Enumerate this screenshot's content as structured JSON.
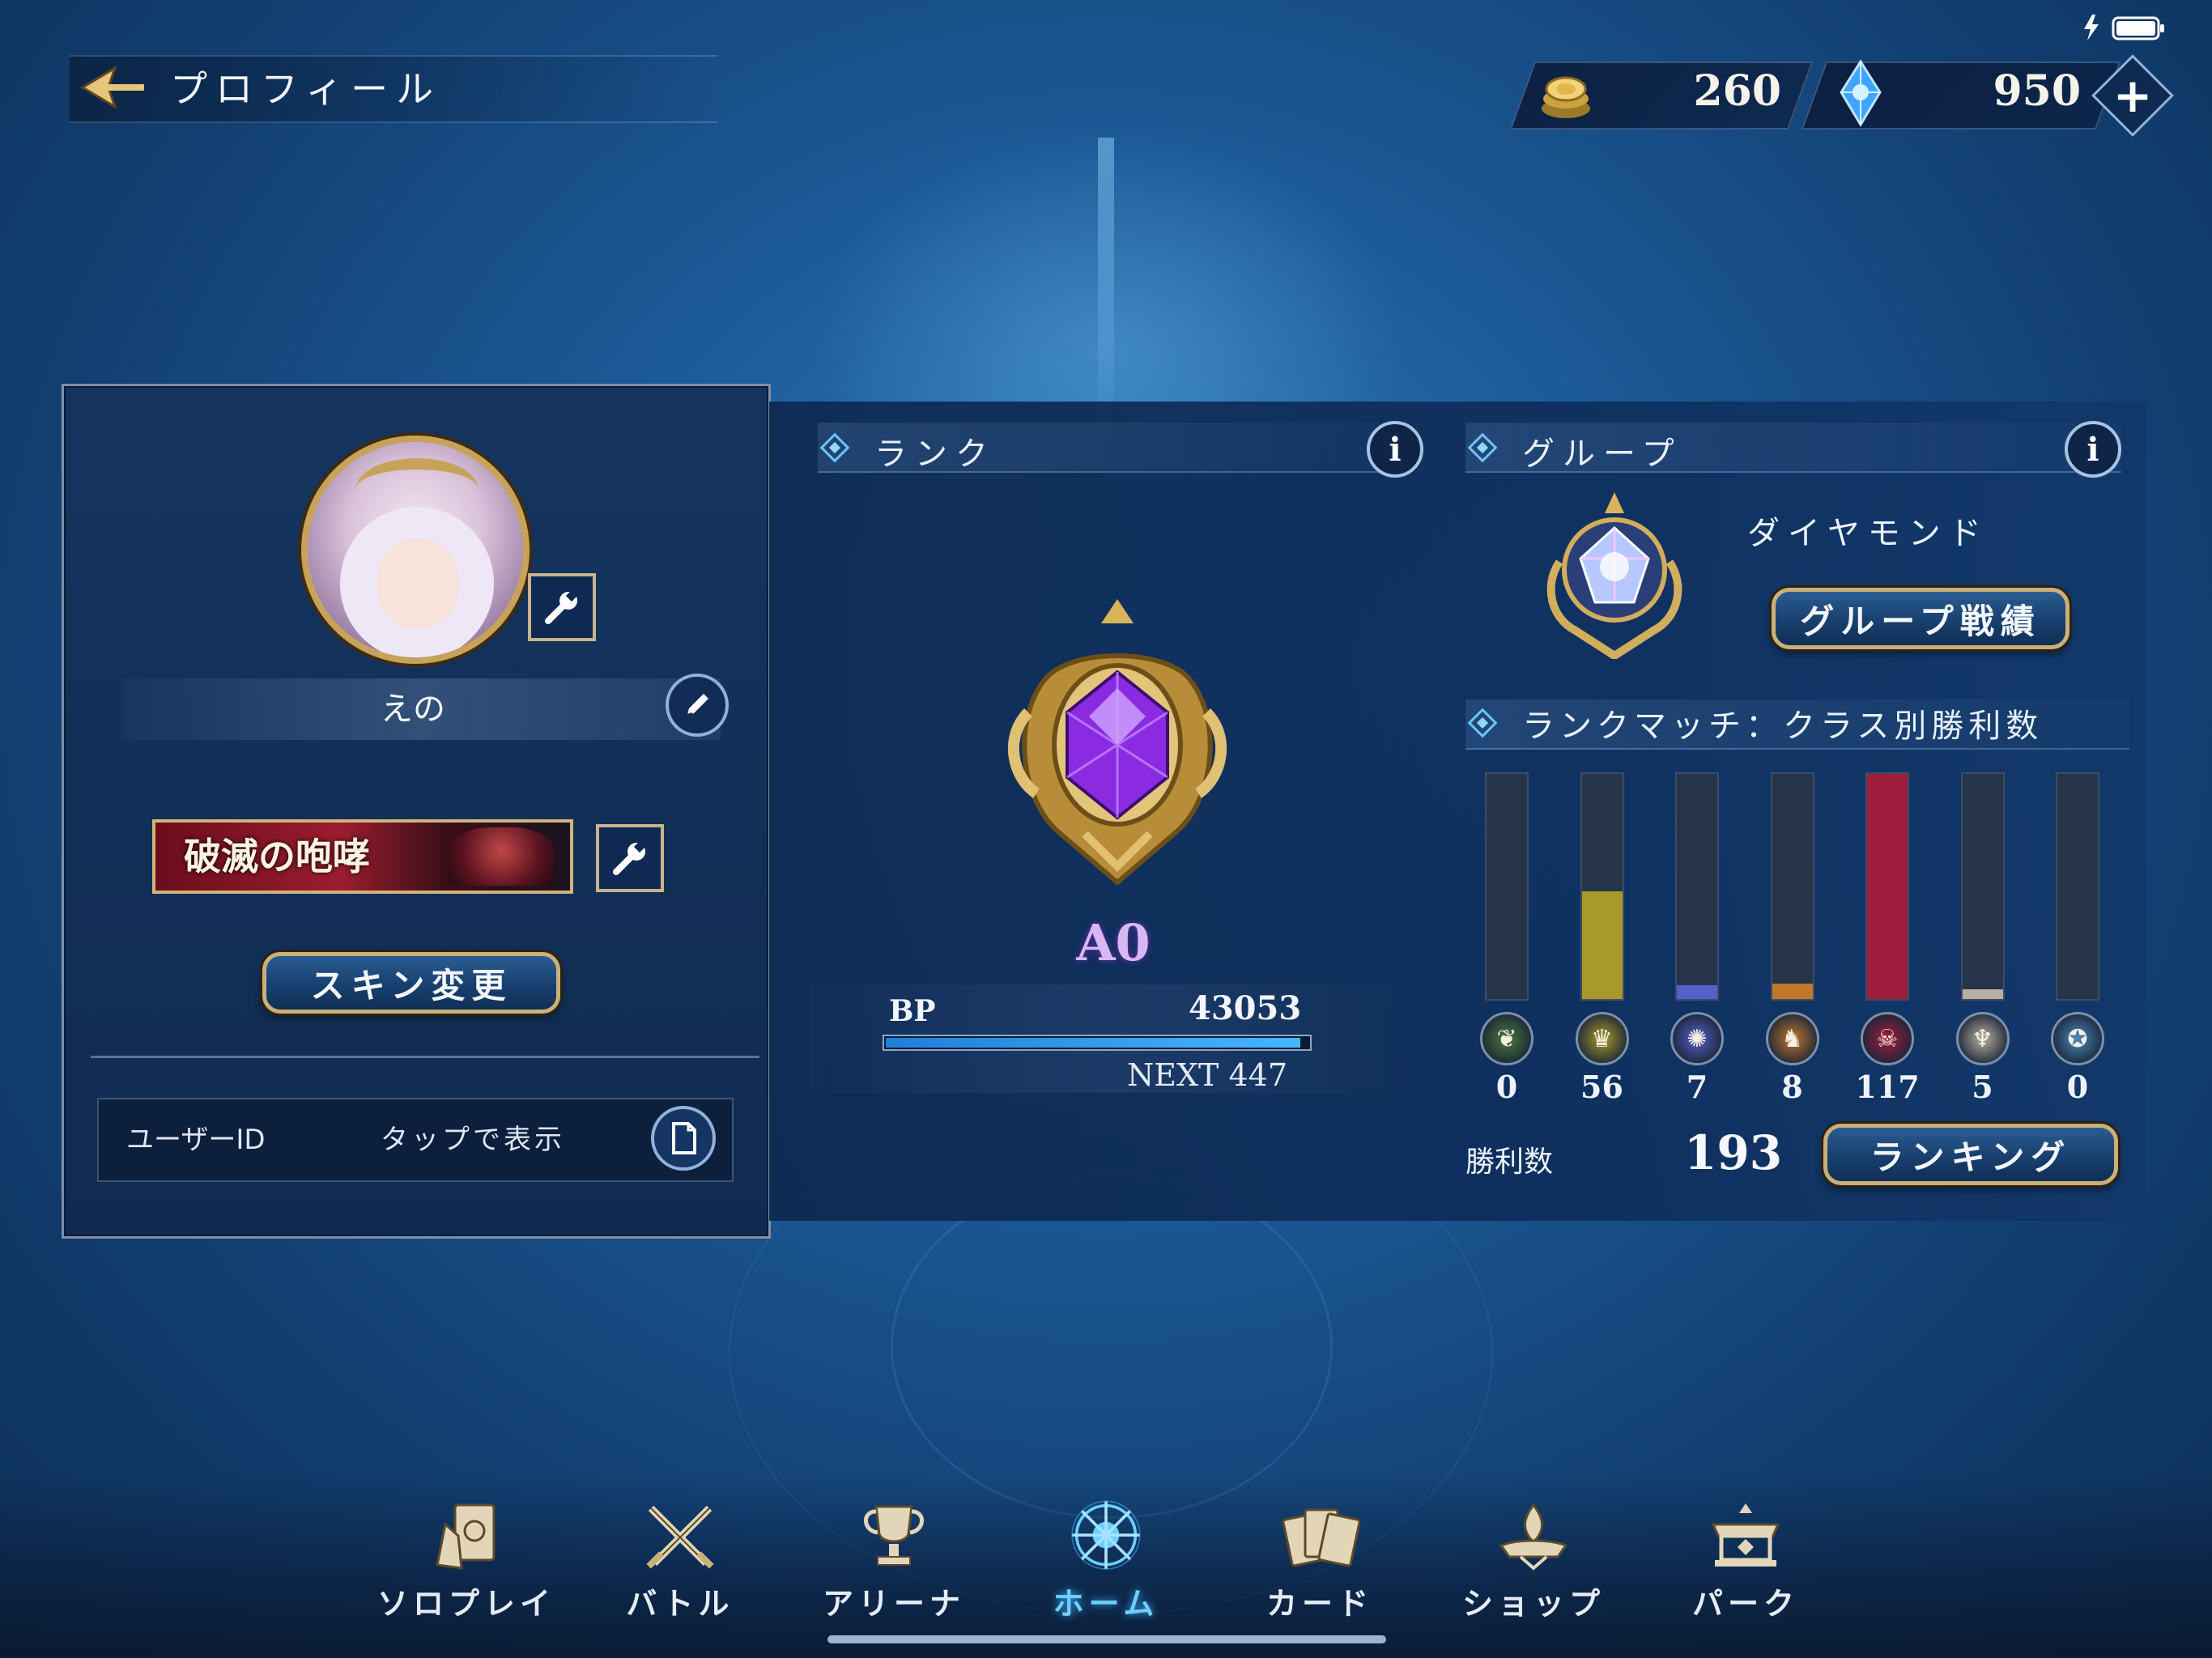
{
  "header": {
    "title": "プロフィール",
    "coins": "260",
    "crystals": "950",
    "plus_label": "+"
  },
  "profile": {
    "player_name": "えの",
    "title_name": "破滅の咆哮",
    "skin_button": "スキン変更",
    "user_id_label": "ユーザーID",
    "user_id_value": "タップで表示"
  },
  "rank": {
    "section_title": "ランク",
    "rank_name": "A0",
    "bp_label": "BP",
    "bp_value": "43053",
    "next_label": "NEXT 447",
    "bp_progress": 0.98
  },
  "group": {
    "section_title": "グループ",
    "group_name": "ダイヤモンド",
    "results_button": "グループ戦績"
  },
  "class_wins": {
    "section_title": "ランクマッチ：クラス別勝利数",
    "max": 117,
    "classes": [
      {
        "icon": "leaf-icon",
        "value": "0",
        "count": 0,
        "color": "#4a7a3a"
      },
      {
        "icon": "crown-icon",
        "value": "56",
        "count": 56,
        "color": "#a79a2b"
      },
      {
        "icon": "rune-circle-icon",
        "value": "7",
        "count": 7,
        "color": "#5560c8"
      },
      {
        "icon": "dragon-icon",
        "value": "8",
        "count": 8,
        "color": "#c0782a"
      },
      {
        "icon": "skull-icon",
        "value": "117",
        "count": 117,
        "color": "#a01c3c"
      },
      {
        "icon": "bat-wing-icon",
        "value": "5",
        "count": 5,
        "color": "#b8b0a0"
      },
      {
        "icon": "swirl-icon",
        "value": "0",
        "count": 0,
        "color": "#4a88b8"
      }
    ],
    "wins_label": "勝利数",
    "wins_total": "193",
    "ranking_button": "ランキング"
  },
  "nav": {
    "items": [
      {
        "label": "ソロプレイ",
        "icon": "solo-play-icon"
      },
      {
        "label": "バトル",
        "icon": "crossed-swords-icon"
      },
      {
        "label": "アリーナ",
        "icon": "trophy-icon"
      },
      {
        "label": "ホーム",
        "icon": "home-crest-icon"
      },
      {
        "label": "カード",
        "icon": "cards-icon"
      },
      {
        "label": "ショップ",
        "icon": "shop-icon"
      },
      {
        "label": "パーク",
        "icon": "park-icon"
      }
    ],
    "active_index": 3
  },
  "colors": {
    "accent_blue": "#47b6ff",
    "gold_border": "#c9b07a",
    "rank_purple": "#8a2be2"
  }
}
